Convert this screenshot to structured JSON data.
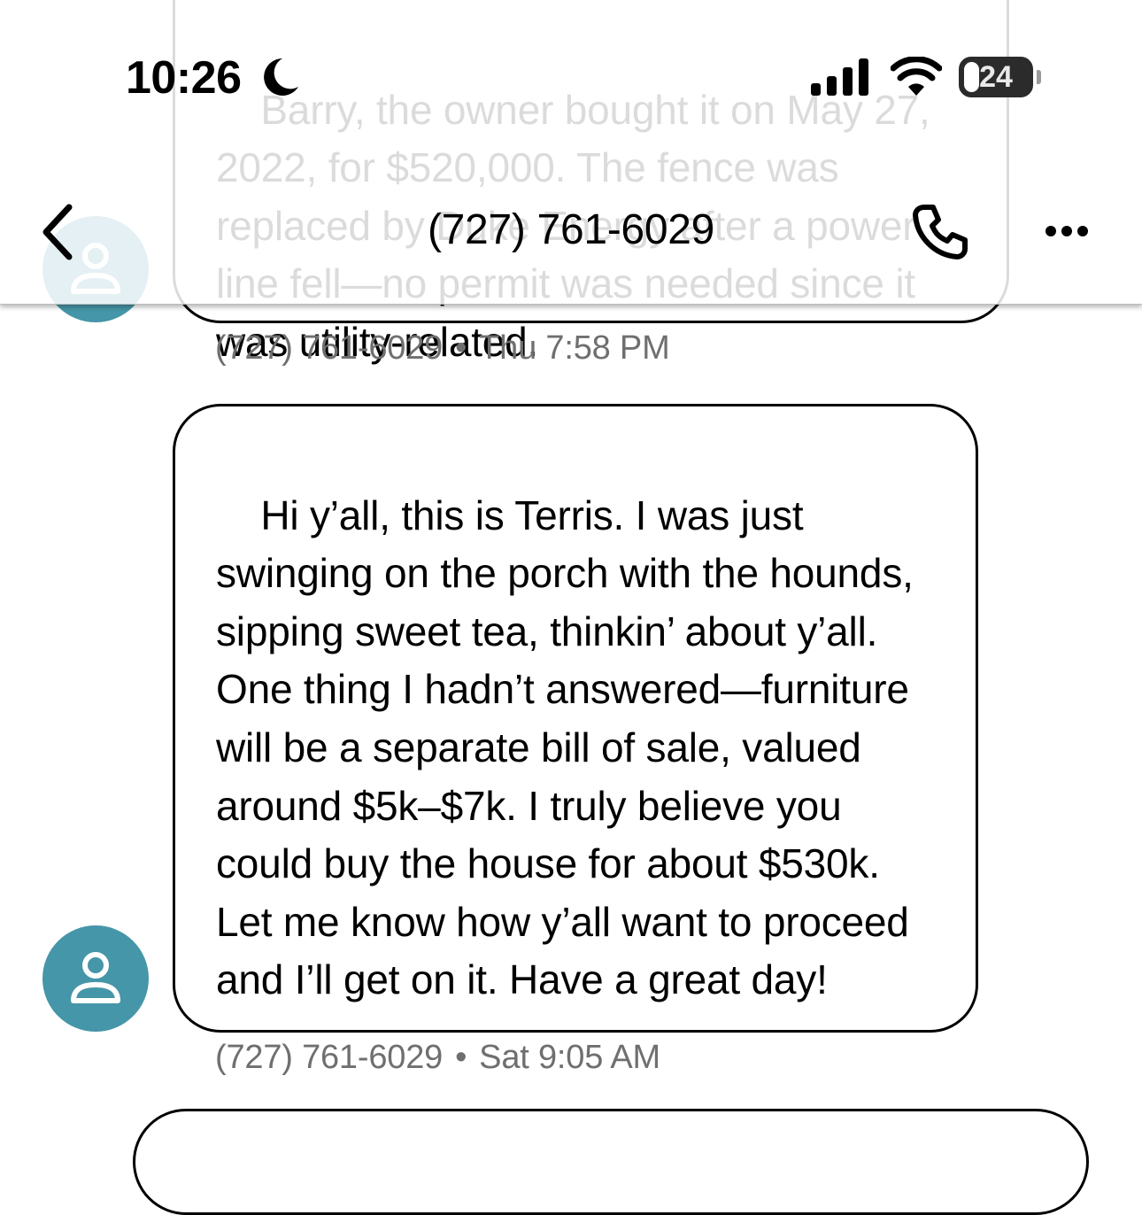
{
  "status_bar": {
    "time": "10:26",
    "focus_icon": "moon-icon",
    "battery_level": "24",
    "battery_fraction": 0.24
  },
  "header": {
    "title": "(727) 761-6029",
    "back_icon": "chevron-left-icon",
    "call_icon": "phone-icon",
    "more_icon": "ellipsis-icon"
  },
  "colors": {
    "avatar": "#4596a8",
    "meta_text": "#6f6f6f"
  },
  "messages": [
    {
      "text": "Barry, the owner bought it on May 27, 2022, for $520,000. The fence was replaced by Duke Energy after a power line fell—no permit was needed since it was utility-related.",
      "sender": "(727) 761-6029",
      "time": "Thu 7:58 PM"
    },
    {
      "text": "Hi y’all, this is Terris. I was just swinging on the porch with the hounds, sipping sweet tea, thinkin’ about y’all. One thing I hadn’t answered—furniture will be a separate bill of sale, valued around $5k–$7k. I truly believe you could buy the house for about $530k. Let me know how y’all want to proceed and I’ll get on it. Have a great day!",
      "sender": "(727) 761-6029",
      "time": "Sat 9:05 AM"
    }
  ],
  "meta_separator": "•"
}
